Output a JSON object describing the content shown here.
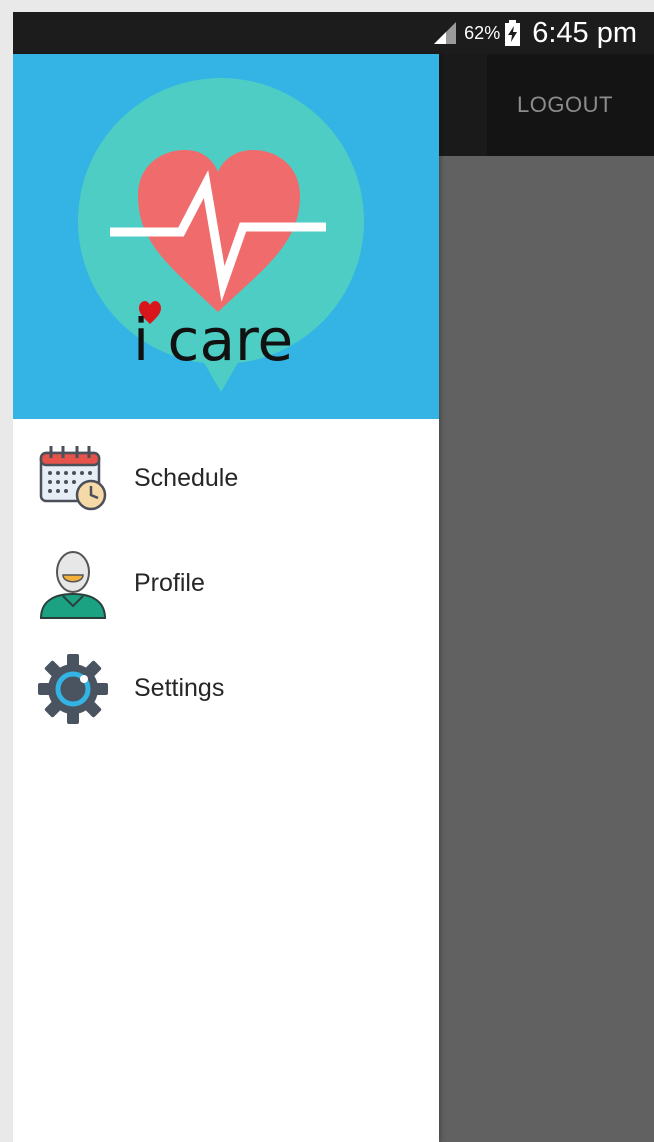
{
  "status_bar": {
    "battery_percent": "62%",
    "time": "6:45 pm"
  },
  "app_bar": {
    "logout_label": "LOGOUT"
  },
  "drawer": {
    "logo_text": "i care",
    "items": [
      {
        "label": "Schedule",
        "icon": "calendar-clock-icon"
      },
      {
        "label": "Profile",
        "icon": "user-avatar-icon"
      },
      {
        "label": "Settings",
        "icon": "gear-icon"
      }
    ]
  },
  "colors": {
    "drawer_header": "#34b4e4",
    "logo_bubble": "#4ecdc4",
    "heart": "#f06b6b",
    "app_bar": "#141414",
    "scrim": "#616161"
  }
}
